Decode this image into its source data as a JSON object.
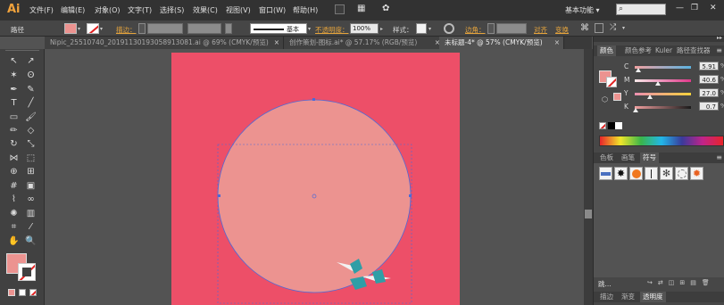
{
  "app": {
    "logo": "Ai"
  },
  "menu": [
    "文件(F)",
    "编辑(E)",
    "对象(O)",
    "文字(T)",
    "选择(S)",
    "效果(C)",
    "视图(V)",
    "窗口(W)",
    "帮助(H)"
  ],
  "workspace": {
    "label": "基本功能",
    "chevron": "▾",
    "search_icon": "⌕"
  },
  "window_controls": {
    "minimize": "—",
    "restore": "❐",
    "close": "✕"
  },
  "control_bar": {
    "path_label": "路径",
    "stroke_label": "描边：",
    "basic_label": "基本",
    "opacity_label": "不透明度：",
    "opacity_value": "100%",
    "style_label": "样式：",
    "corner_label": "边角：",
    "align_label": "对齐",
    "transform_label": "变换"
  },
  "tabs": [
    {
      "label": "Nipic_25510740_20191130193058913081.ai @ 69% (CMYK/预览)",
      "close": "×",
      "active": false
    },
    {
      "label": "创作策划-图标.ai* @ 57.17% (RGB/预览)",
      "close": "×",
      "active": false
    },
    {
      "label": "未标题-4* @ 57% (CMYK/预览)",
      "close": "×",
      "active": true
    }
  ],
  "panel": {
    "tabs": [
      "颜色",
      "颜色参考",
      "Kuler",
      "路径查找器"
    ],
    "collapse": "▸▸",
    "menu": "≡",
    "sliders": [
      {
        "label": "C",
        "value": "5.91",
        "unit": "%",
        "fraction": 0.06
      },
      {
        "label": "M",
        "value": "40.6",
        "unit": "%",
        "fraction": 0.41
      },
      {
        "label": "Y",
        "value": "27.0",
        "unit": "%",
        "fraction": 0.27
      },
      {
        "label": "K",
        "value": "0.7",
        "unit": "%",
        "fraction": 0.01
      }
    ],
    "swatch_tabs": [
      "色板",
      "画笔",
      "符号"
    ],
    "bottom_label": "跳...",
    "bottom_tabs": [
      "描边",
      "渐变",
      "透明度"
    ]
  },
  "colors": {
    "artboard": "#ed4f68",
    "circle": "#ec9390",
    "fill_swatch": "#ec9390",
    "selection": "#4c6ad8",
    "pin": "#2f9ea6"
  }
}
